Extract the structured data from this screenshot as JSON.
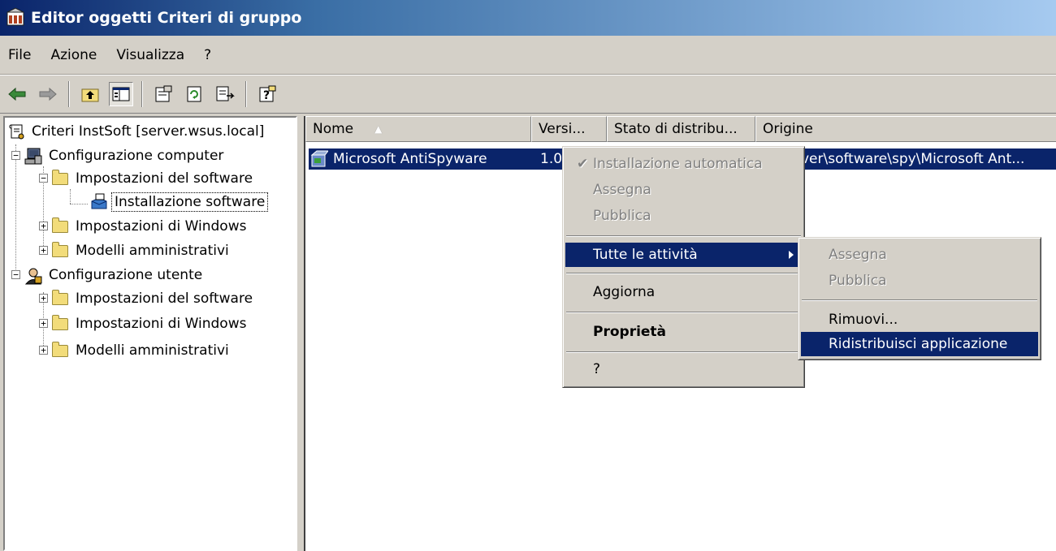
{
  "window": {
    "title": "Editor oggetti Criteri di gruppo"
  },
  "menubar": {
    "items": [
      "File",
      "Azione",
      "Visualizza",
      "?"
    ]
  },
  "toolbar": {
    "buttons": [
      "back-arrow-icon",
      "forward-arrow-icon",
      "up-folder-icon",
      "show-hide-tree-icon",
      "properties-icon",
      "refresh-icon",
      "export-list-icon",
      "help-icon"
    ]
  },
  "tree": {
    "root": "Criteri InstSoft [server.wsus.local]",
    "computer": "Configurazione computer",
    "computer_software": "Impostazioni del software",
    "software_install": "Installazione software",
    "computer_windows": "Impostazioni di Windows",
    "computer_admin": "Modelli amministrativi",
    "user": "Configurazione utente",
    "user_software": "Impostazioni del software",
    "user_windows": "Impostazioni di Windows",
    "user_admin": "Modelli amministrativi"
  },
  "list": {
    "columns": [
      "Nome",
      "Versi...",
      "Stato di distribu...",
      "Origine"
    ],
    "sort_indicator": "▲",
    "rows": [
      {
        "name": "Microsoft AntiSpyware",
        "version": "1.0",
        "source": "ver\\software\\spy\\Microsoft Ant..."
      }
    ]
  },
  "context_menu": {
    "auto_install": "Installazione automatica",
    "assign": "Assegna",
    "publish": "Pubblica",
    "all_tasks": "Tutte le attività",
    "refresh": "Aggiorna",
    "properties": "Proprietà",
    "help": "?"
  },
  "submenu": {
    "assign": "Assegna",
    "publish": "Pubblica",
    "remove": "Rimuovi...",
    "redeploy": "Ridistribuisci applicazione"
  },
  "colors": {
    "selection": "#0a246a",
    "face": "#d4d0c8"
  }
}
